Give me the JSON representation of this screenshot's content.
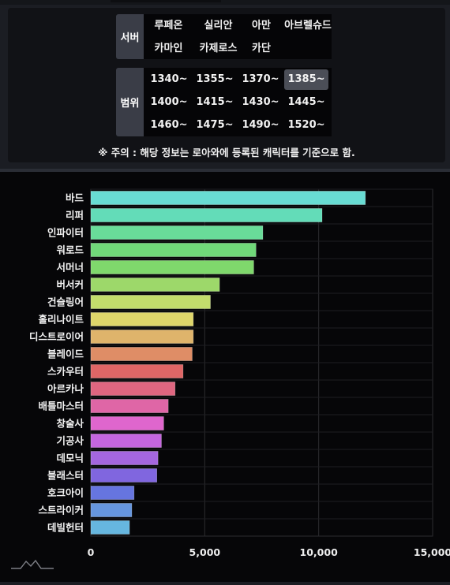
{
  "filters": {
    "server": {
      "label": "서버",
      "options": [
        "루페온",
        "실리안",
        "아만",
        "아브렐슈드",
        "카마인",
        "카제로스",
        "카단"
      ]
    },
    "range": {
      "label": "범위",
      "options": [
        "1340~",
        "1355~",
        "1370~",
        "1385~",
        "1400~",
        "1415~",
        "1430~",
        "1445~",
        "1460~",
        "1475~",
        "1490~",
        "1520~"
      ],
      "selected": "1385~"
    },
    "notice": "※ 주의 : 해당 정보는 로아와에 등록된 캐릭터를 기준으로 함."
  },
  "chart_data": {
    "type": "bar",
    "orientation": "horizontal",
    "categories": [
      "바드",
      "리퍼",
      "인파이터",
      "워로드",
      "서머너",
      "버서커",
      "건슬링어",
      "홀리나이트",
      "디스트로이어",
      "블레이드",
      "스카우터",
      "아르카나",
      "배틀마스터",
      "창술사",
      "기공사",
      "데모닉",
      "블래스터",
      "호크아이",
      "스트라이커",
      "데빌헌터"
    ],
    "values": [
      12050,
      10150,
      7550,
      7250,
      7150,
      5650,
      5250,
      4500,
      4500,
      4450,
      4050,
      3700,
      3400,
      3200,
      3100,
      2950,
      2900,
      1900,
      1800,
      1700
    ],
    "colors": [
      "#68dcd3",
      "#63dcb8",
      "#69dc99",
      "#70d879",
      "#7fd86c",
      "#9dd86a",
      "#c2dc6c",
      "#dfd66b",
      "#dfb46b",
      "#df8d66",
      "#df6666",
      "#df6680",
      "#df66a6",
      "#df66cd",
      "#c566df",
      "#a466df",
      "#8066df",
      "#6675df",
      "#6696df",
      "#66b6df"
    ],
    "xticks": [
      "0",
      "5,000",
      "10,000",
      "15,000"
    ],
    "xlim": [
      0,
      15000
    ],
    "title": "",
    "xlabel": "",
    "ylabel": "",
    "grid": true
  }
}
